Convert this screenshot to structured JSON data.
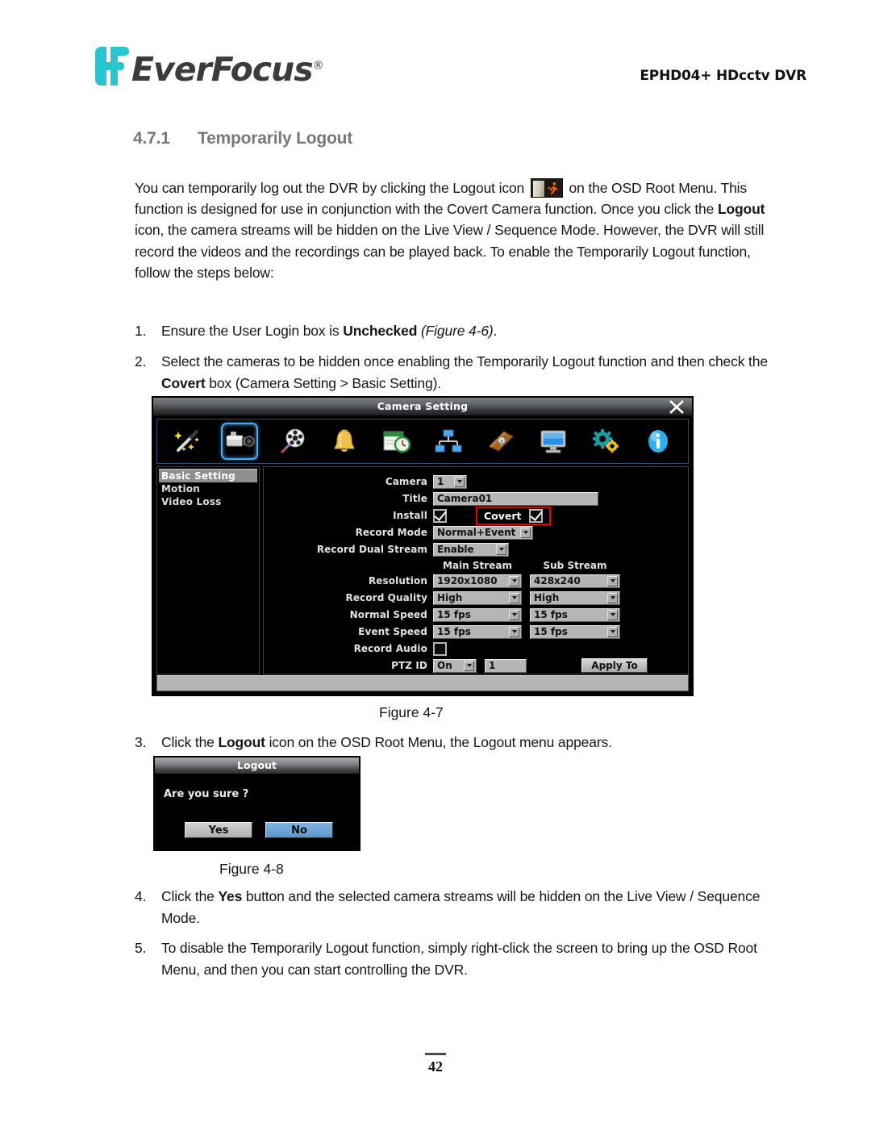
{
  "header": {
    "logo_text": "EverFocus",
    "logo_reg": "®",
    "model": "EPHD04+  HDcctv DVR"
  },
  "section": {
    "number": "4.7.1",
    "title": "Temporarily Logout"
  },
  "intro": {
    "part1": "You can temporarily log out the DVR by clicking the Logout icon ",
    "part2": " on the OSD Root Menu. This function is designed for use in conjunction with the Covert Camera function. Once you click the ",
    "bold1": "Logout",
    "part3": " icon, the camera streams will be hidden on the Live View / Sequence Mode. However, the DVR will still record the videos and the recordings can be played back. To enable the Temporarily Logout function, follow the steps below:"
  },
  "steps": {
    "s1": {
      "marker": "1.",
      "a": "Ensure the User Login box is ",
      "bold": "Unchecked",
      "b": " ",
      "ital": "(Figure 4-6)",
      "c": "."
    },
    "s2": {
      "marker": "2.",
      "a": "Select the cameras to be hidden once enabling the Temporarily Logout function and then check the ",
      "bold": "Covert",
      "b": " box (Camera Setting > Basic Setting)."
    },
    "s3": {
      "marker": "3.",
      "a": "Click the ",
      "bold": "Logout",
      "b": " icon on the OSD Root Menu, the Logout menu appears."
    },
    "s4": {
      "marker": "4.",
      "a": "Click the ",
      "bold": "Yes",
      "b": " button and the selected camera streams will be hidden on the Live View / Sequence Mode."
    },
    "s5": {
      "marker": "5.",
      "a": "To disable the Temporarily Logout function, simply right-click the screen to bring up the OSD Root Menu, and then you can start controlling the DVR.",
      "bold": "",
      "b": ""
    }
  },
  "figures": {
    "fig7_caption": "Figure 4-7",
    "fig8_caption": "Figure 4-8"
  },
  "camera_setting": {
    "title": "Camera Setting",
    "close_icon": "close-icon",
    "toolbar_icons": [
      "wizard-icon",
      "camera-icon",
      "record-icon",
      "alarm-bell-icon",
      "schedule-icon",
      "network-icon",
      "disk-icon",
      "display-icon",
      "system-settings-icon",
      "information-icon"
    ],
    "selected_toolbar_index": 1,
    "sidebar": [
      {
        "label": "Basic Setting",
        "active": true
      },
      {
        "label": "Motion",
        "active": false
      },
      {
        "label": "Video Loss",
        "active": false
      }
    ],
    "fields": {
      "camera_label": "Camera",
      "camera_value": "1",
      "title_label": "Title",
      "title_value": "Camera01",
      "install_label": "Install",
      "install_checked": true,
      "covert_label": "Covert",
      "covert_checked": true,
      "record_mode_label": "Record Mode",
      "record_mode_value": "Normal+Event",
      "record_dual_stream_label": "Record Dual Stream",
      "record_dual_stream_value": "Enable",
      "main_stream_header": "Main Stream",
      "sub_stream_header": "Sub Stream",
      "resolution_label": "Resolution",
      "resolution_main": "1920x1080",
      "resolution_sub": "428x240",
      "record_quality_label": "Record Quality",
      "record_quality_main": "High",
      "record_quality_sub": "High",
      "normal_speed_label": "Normal Speed",
      "normal_speed_main": "15 fps",
      "normal_speed_sub": "15 fps",
      "event_speed_label": "Event Speed",
      "event_speed_main": "15 fps",
      "event_speed_sub": "15 fps",
      "record_audio_label": "Record Audio",
      "record_audio_checked": false,
      "ptz_id_label": "PTZ ID",
      "ptz_id_value": "On",
      "ptz_id_number": "1",
      "apply_to_label": "Apply To"
    }
  },
  "logout_dialog": {
    "title": "Logout",
    "message": "Are you sure ?",
    "yes_label": "Yes",
    "no_label": "No"
  },
  "footer": {
    "page_number": "42"
  },
  "colors": {
    "brand_cyan": "#29c5ce",
    "heading_gray": "#77787a",
    "highlight_red": "#e60000",
    "selected_blue": "#4ea8ef",
    "no_button_blue": "#5b96cd"
  }
}
